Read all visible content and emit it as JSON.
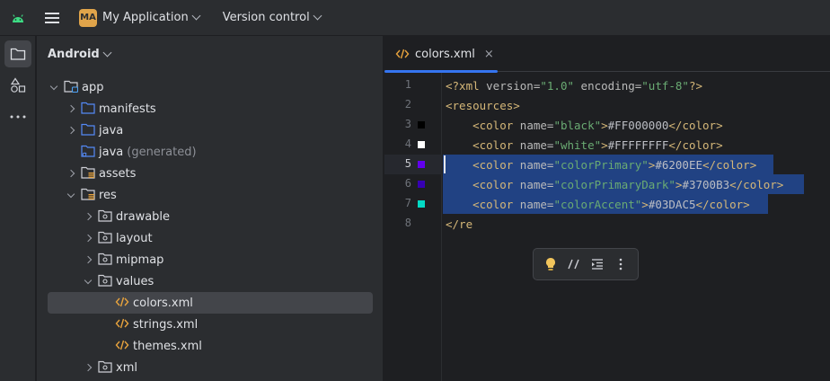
{
  "titlebar": {
    "project_initials": "MA",
    "project_name": "My Application",
    "vcs_label": "Version control"
  },
  "panel": {
    "title": "Android"
  },
  "tree": [
    {
      "label": "app",
      "depth": 0,
      "arrow": "down",
      "icon": "module-folder-icon"
    },
    {
      "label": "manifests",
      "depth": 1,
      "arrow": "right",
      "icon": "folder-icon"
    },
    {
      "label": "java",
      "depth": 1,
      "arrow": "right",
      "icon": "folder-icon"
    },
    {
      "label": "java",
      "suffix": "(generated)",
      "depth": 1,
      "arrow": "none",
      "icon": "generated-folder-icon"
    },
    {
      "label": "assets",
      "depth": 1,
      "arrow": "right",
      "icon": "resource-folder-icon"
    },
    {
      "label": "res",
      "depth": 1,
      "arrow": "down",
      "icon": "resource-folder-icon"
    },
    {
      "label": "drawable",
      "depth": 2,
      "arrow": "right",
      "icon": "package-folder-icon"
    },
    {
      "label": "layout",
      "depth": 2,
      "arrow": "right",
      "icon": "package-folder-icon"
    },
    {
      "label": "mipmap",
      "depth": 2,
      "arrow": "right",
      "icon": "package-folder-icon"
    },
    {
      "label": "values",
      "depth": 2,
      "arrow": "down",
      "icon": "package-folder-icon"
    },
    {
      "label": "colors.xml",
      "depth": 3,
      "arrow": "none",
      "icon": "xml-file-icon",
      "selected": true
    },
    {
      "label": "strings.xml",
      "depth": 3,
      "arrow": "none",
      "icon": "xml-file-icon"
    },
    {
      "label": "themes.xml",
      "depth": 3,
      "arrow": "none",
      "icon": "xml-file-icon"
    },
    {
      "label": "xml",
      "depth": 2,
      "arrow": "right",
      "icon": "package-folder-icon"
    }
  ],
  "editor": {
    "tab_name": "colors.xml",
    "tab_close": "×",
    "current_line": 5,
    "lines": [
      {
        "n": "1",
        "parts": [
          [
            "t-tag",
            "<?xml "
          ],
          [
            "t-attr",
            "version="
          ],
          [
            "t-str",
            "\"1.0\""
          ],
          [
            "t-attr",
            " encoding="
          ],
          [
            "t-str",
            "\"utf-8\""
          ],
          [
            "t-tag",
            "?>"
          ]
        ]
      },
      {
        "n": "2",
        "parts": [
          [
            "t-tag",
            "<resources>"
          ]
        ]
      },
      {
        "n": "3",
        "swatch": "#FF000000",
        "parts": [
          [
            "t-txt",
            "    "
          ],
          [
            "t-tag",
            "<color "
          ],
          [
            "t-attr",
            "name="
          ],
          [
            "t-str",
            "\"black\""
          ],
          [
            "t-tag",
            ">"
          ],
          [
            "t-txt",
            "#FF000000"
          ],
          [
            "t-tag",
            "</color>"
          ]
        ]
      },
      {
        "n": "4",
        "swatch": "#FFFFFFFF",
        "parts": [
          [
            "t-txt",
            "    "
          ],
          [
            "t-tag",
            "<color "
          ],
          [
            "t-attr",
            "name="
          ],
          [
            "t-str",
            "\"white\""
          ],
          [
            "t-tag",
            ">"
          ],
          [
            "t-txt",
            "#FFFFFFFF"
          ],
          [
            "t-tag",
            "</color>"
          ]
        ]
      },
      {
        "n": "5",
        "swatch": "#6200EE",
        "selected": true,
        "parts": [
          [
            "t-txt",
            "    "
          ],
          [
            "t-tag",
            "<color "
          ],
          [
            "t-attr",
            "name="
          ],
          [
            "t-str",
            "\"colorPrimary\""
          ],
          [
            "t-tag",
            ">"
          ],
          [
            "t-txt",
            "#6200EE"
          ],
          [
            "t-tag",
            "</color>"
          ]
        ]
      },
      {
        "n": "6",
        "swatch": "#3700B3",
        "selected": true,
        "parts": [
          [
            "t-txt",
            "    "
          ],
          [
            "t-tag",
            "<color "
          ],
          [
            "t-attr",
            "name="
          ],
          [
            "t-str",
            "\"colorPrimaryDark\""
          ],
          [
            "t-tag",
            ">"
          ],
          [
            "t-txt",
            "#3700B3"
          ],
          [
            "t-tag",
            "</color>"
          ]
        ]
      },
      {
        "n": "7",
        "swatch": "#03DAC5",
        "selected": true,
        "parts": [
          [
            "t-txt",
            "    "
          ],
          [
            "t-tag",
            "<color "
          ],
          [
            "t-attr",
            "name="
          ],
          [
            "t-str",
            "\"colorAccent\""
          ],
          [
            "t-tag",
            ">"
          ],
          [
            "t-txt",
            "#03DAC5"
          ],
          [
            "t-tag",
            "</color>"
          ]
        ]
      },
      {
        "n": "8",
        "parts": [
          [
            "t-tag",
            "</re"
          ]
        ]
      }
    ]
  },
  "popup": {
    "items": [
      "lightbulb-icon",
      "comment-icon",
      "reformat-icon",
      "more-vertical-icon"
    ]
  },
  "colors": {
    "selection": "#214283",
    "accent": "#3574f0"
  }
}
